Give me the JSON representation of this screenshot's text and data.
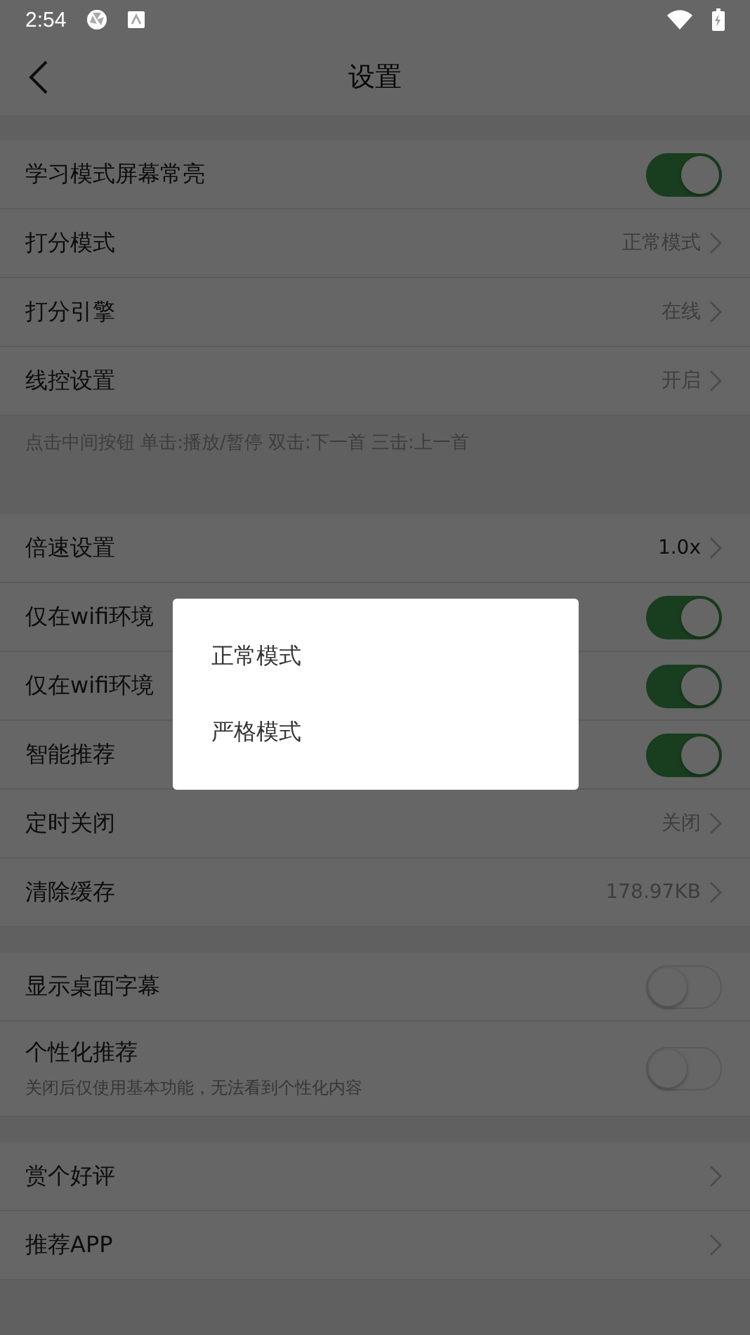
{
  "status_bar": {
    "time": "2:54"
  },
  "header": {
    "title": "设置"
  },
  "sections": [
    {
      "items": [
        {
          "kind": "toggle",
          "label": "学习模式屏幕常亮",
          "on": true
        },
        {
          "kind": "link",
          "label": "打分模式",
          "value": "正常模式"
        },
        {
          "kind": "link",
          "label": "打分引擎",
          "value": "在线"
        },
        {
          "kind": "link",
          "label": "线控设置",
          "value": "开启"
        }
      ],
      "note": "点击中间按钮 单击:播放/暂停 双击:下一首 三击:上一首"
    },
    {
      "items": [
        {
          "kind": "link",
          "label": "倍速设置",
          "value": "1.0x",
          "strong": true
        },
        {
          "kind": "toggle",
          "label": "仅在wifi环境",
          "on": true
        },
        {
          "kind": "toggle",
          "label": "仅在wifi环境",
          "on": true
        },
        {
          "kind": "toggle",
          "label": "智能推荐",
          "on": true
        },
        {
          "kind": "link",
          "label": "定时关闭",
          "value": "关闭"
        },
        {
          "kind": "link",
          "label": "清除缓存",
          "value": "178.97KB"
        }
      ]
    },
    {
      "items": [
        {
          "kind": "toggle",
          "label": "显示桌面字幕",
          "on": false
        },
        {
          "kind": "toggle",
          "label": "个性化推荐",
          "hint": "关闭后仅使用基本功能，无法看到个性化内容",
          "on": false
        }
      ]
    },
    {
      "items": [
        {
          "kind": "link",
          "label": "赏个好评"
        },
        {
          "kind": "link",
          "label": "推荐APP"
        }
      ]
    }
  ],
  "dialog": {
    "options": [
      {
        "label": "正常模式"
      },
      {
        "label": "严格模式"
      }
    ]
  }
}
